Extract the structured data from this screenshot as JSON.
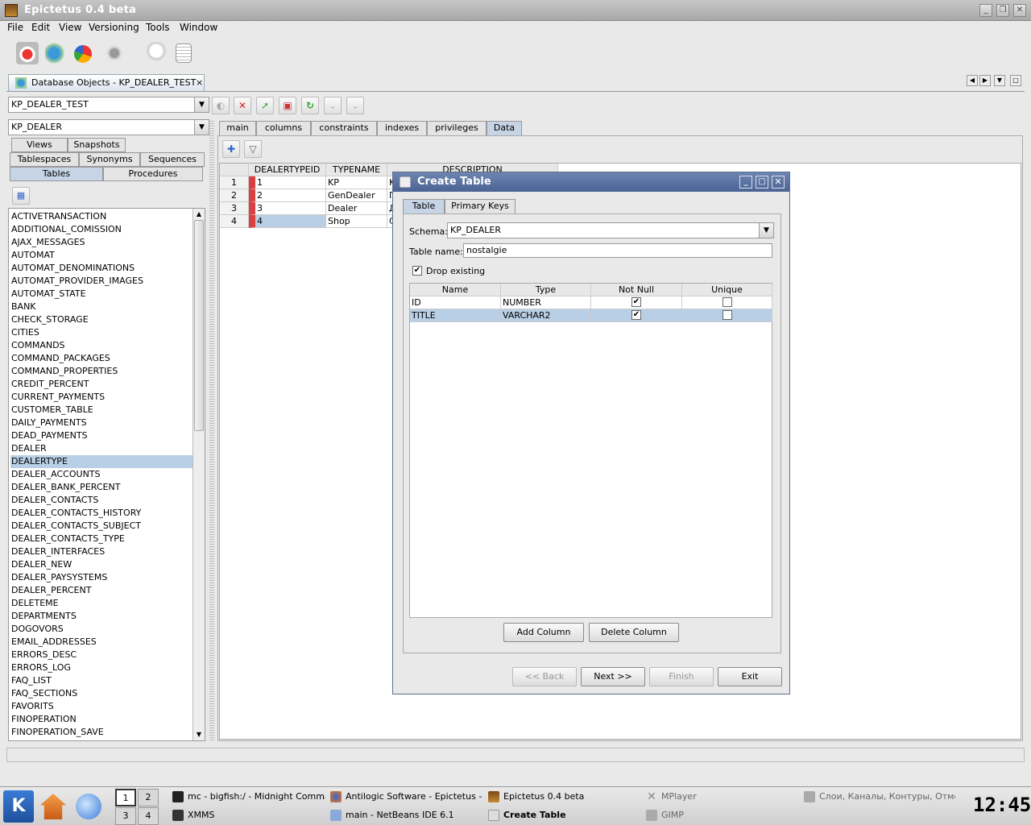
{
  "window": {
    "title": "Epictetus 0.4 beta"
  },
  "menu": [
    "File",
    "Edit",
    "View",
    "Versioning",
    "Tools",
    "Window"
  ],
  "doc_tab": {
    "label": "Database Objects - KP_DEALER_TEST",
    "close": "×"
  },
  "connection": {
    "value": "KP_DEALER_TEST"
  },
  "schema": {
    "value": "KP_DEALER"
  },
  "object_tabs": {
    "row1": [
      "Views",
      "Snapshots"
    ],
    "row2": [
      "Tablespaces",
      "Synonyms",
      "Sequences"
    ],
    "row3": [
      "Tables",
      "Procedures"
    ]
  },
  "tables": [
    "ACTIVETRANSACTION",
    "ADDITIONAL_COMISSION",
    "AJAX_MESSAGES",
    "AUTOMAT",
    "AUTOMAT_DENOMINATIONS",
    "AUTOMAT_PROVIDER_IMAGES",
    "AUTOMAT_STATE",
    "BANK",
    "CHECK_STORAGE",
    "CITIES",
    "COMMANDS",
    "COMMAND_PACKAGES",
    "COMMAND_PROPERTIES",
    "CREDIT_PERCENT",
    "CURRENT_PAYMENTS",
    "CUSTOMER_TABLE",
    "DAILY_PAYMENTS",
    "DEAD_PAYMENTS",
    "DEALER",
    "DEALERTYPE",
    "DEALER_ACCOUNTS",
    "DEALER_BANK_PERCENT",
    "DEALER_CONTACTS",
    "DEALER_CONTACTS_HISTORY",
    "DEALER_CONTACTS_SUBJECT",
    "DEALER_CONTACTS_TYPE",
    "DEALER_INTERFACES",
    "DEALER_NEW",
    "DEALER_PAYSYSTEMS",
    "DEALER_PERCENT",
    "DELETEME",
    "DEPARTMENTS",
    "DOGOVORS",
    "EMAIL_ADDRESSES",
    "ERRORS_DESC",
    "ERRORS_LOG",
    "FAQ_LIST",
    "FAQ_SECTIONS",
    "FAVORITS",
    "FINOPERATION",
    "FINOPERATION_SAVE"
  ],
  "selected_table": "DEALERTYPE",
  "detail_tabs": [
    "main",
    "columns",
    "constraints",
    "indexes",
    "privileges",
    "Data"
  ],
  "data_grid": {
    "headers": [
      "DEALERTYPEID",
      "TYPENAME",
      "DESCRIPTION"
    ],
    "rows": [
      {
        "n": "1",
        "id": "1",
        "name": "KP",
        "desc": "K"
      },
      {
        "n": "2",
        "id": "2",
        "name": "GenDealer",
        "desc": "Г"
      },
      {
        "n": "3",
        "id": "3",
        "name": "Dealer",
        "desc": "Д"
      },
      {
        "n": "4",
        "id": "4",
        "name": "Shop",
        "desc": "С"
      }
    ]
  },
  "dialog": {
    "title": "Create Table",
    "tabs": [
      "Table",
      "Primary Keys"
    ],
    "schema_label": "Schema:",
    "schema_value": "KP_DEALER",
    "table_name_label": "Table name:",
    "table_name_value": "nostalgie",
    "drop_existing_label": "Drop existing",
    "drop_existing_checked": true,
    "columns_headers": [
      "Name",
      "Type",
      "Not Null",
      "Unique"
    ],
    "columns": [
      {
        "name": "ID",
        "type": "NUMBER",
        "not_null": true,
        "unique": false
      },
      {
        "name": "TITLE",
        "type": "VARCHAR2",
        "not_null": true,
        "unique": false
      }
    ],
    "add_column": "Add Column",
    "delete_column": "Delete Column",
    "back": "<< Back",
    "next": "Next >>",
    "finish": "Finish",
    "exit": "Exit"
  },
  "taskbar": {
    "pagers": [
      "1",
      "2",
      "3",
      "4"
    ],
    "tasks": [
      "mc - bigfish:/ - Midnight Commander",
      "XMMS",
      "Antilogic Software - Epictetus - Mozilla",
      "main - NetBeans IDE 6.1",
      "Epictetus 0.4 beta",
      "Create Table",
      "MPlayer",
      "GIMP",
      "Слои, Каналы, Контуры, Отменить"
    ],
    "clock": "12:45"
  },
  "colors": {
    "accent": "#4a6394",
    "selection": "#b8cfe5",
    "row_marker": "#d94040"
  }
}
